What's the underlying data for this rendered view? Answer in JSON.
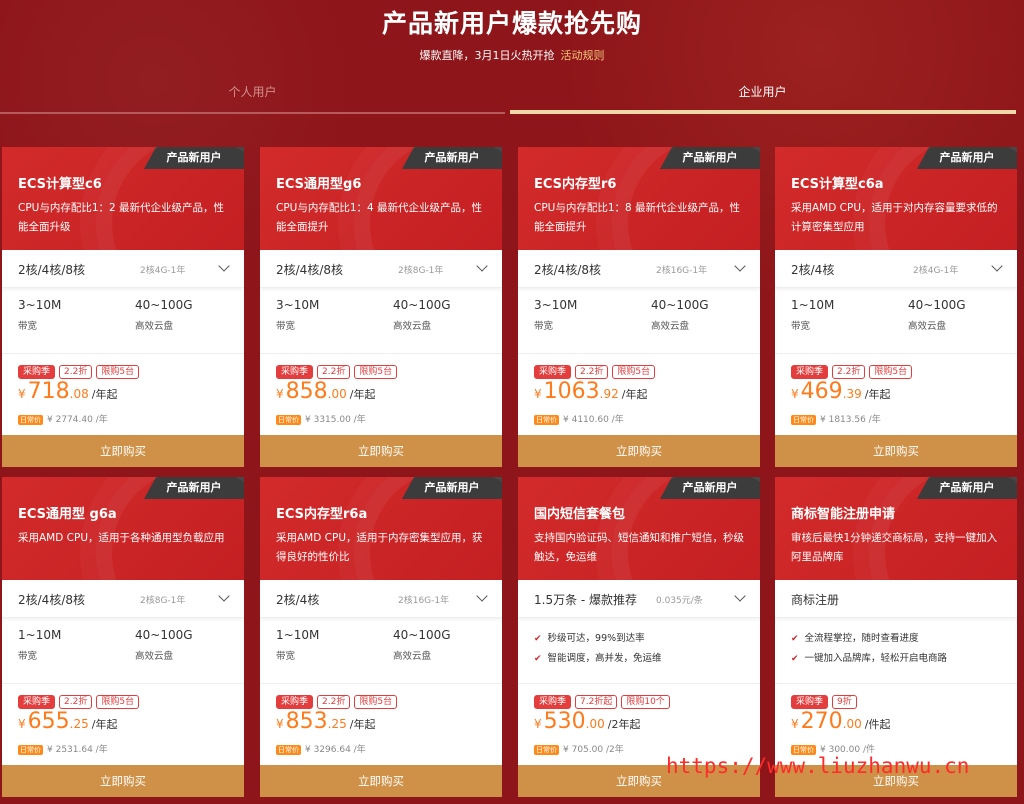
{
  "header": {
    "title": "产品新用户爆款抢先购",
    "subtitle": "爆款直降，3月1日火热开抢",
    "rule_link": "活动规则"
  },
  "tabs": [
    {
      "label": "个人用户",
      "active": false
    },
    {
      "label": "企业用户",
      "active": true
    }
  ],
  "colors": {
    "background": "#8e1519",
    "card_top": "#c41f22",
    "badge": "#3c3c3c",
    "price": "#ff7a1a",
    "buy_button": "#cf9147",
    "tag": "#e33d3d"
  },
  "cards": [
    {
      "badge": "产品新用户",
      "name": "ECS计算型c6",
      "desc": "CPU与内存配比1：2 最新代企业级产品，性能全面升级",
      "spec": "2核/4核/8核",
      "spec_sub": "2核4G-1年",
      "attr1_v": "3~10M",
      "attr1_l": "带宽",
      "attr2_v": "40~100G",
      "attr2_l": "高效云盘",
      "tags": [
        "采购季",
        "2.2折",
        "限购5台"
      ],
      "price_cur": "¥",
      "price_int": "718",
      "price_dec": ".08",
      "price_unit": "/年起",
      "orig_pill": "日常价",
      "orig": "¥ 2774.40 /年",
      "buy": "立即购买"
    },
    {
      "badge": "产品新用户",
      "name": "ECS通用型g6",
      "desc": "CPU与内存配比1：4 最新代企业级产品，性能全面提升",
      "spec": "2核/4核/8核",
      "spec_sub": "2核8G-1年",
      "attr1_v": "3~10M",
      "attr1_l": "带宽",
      "attr2_v": "40~100G",
      "attr2_l": "高效云盘",
      "tags": [
        "采购季",
        "2.2折",
        "限购5台"
      ],
      "price_cur": "¥",
      "price_int": "858",
      "price_dec": ".00",
      "price_unit": "/年起",
      "orig_pill": "日常价",
      "orig": "¥ 3315.00 /年",
      "buy": "立即购买"
    },
    {
      "badge": "产品新用户",
      "name": "ECS内存型r6",
      "desc": "CPU与内存配比1：8 最新代企业级产品，性能全面提升",
      "spec": "2核/4核/8核",
      "spec_sub": "2核16G-1年",
      "attr1_v": "3~10M",
      "attr1_l": "带宽",
      "attr2_v": "40~100G",
      "attr2_l": "高效云盘",
      "tags": [
        "采购季",
        "2.2折",
        "限购5台"
      ],
      "price_cur": "¥",
      "price_int": "1063",
      "price_dec": ".92",
      "price_unit": "/年起",
      "orig_pill": "日常价",
      "orig": "¥ 4110.60 /年",
      "buy": "立即购买"
    },
    {
      "badge": "产品新用户",
      "name": "ECS计算型c6a",
      "desc": "采用AMD CPU，适用于对内存容量要求低的计算密集型应用",
      "spec": "2核/4核",
      "spec_sub": "2核4G-1年",
      "attr1_v": "1~10M",
      "attr1_l": "带宽",
      "attr2_v": "40~100G",
      "attr2_l": "高效云盘",
      "tags": [
        "采购季",
        "2.2折",
        "限购5台"
      ],
      "price_cur": "¥",
      "price_int": "469",
      "price_dec": ".39",
      "price_unit": "/年起",
      "orig_pill": "日常价",
      "orig": "¥ 1813.56 /年",
      "buy": "立即购买"
    },
    {
      "badge": "产品新用户",
      "name": "ECS通用型 g6a",
      "desc": "采用AMD CPU，适用于各种通用型负载应用",
      "spec": "2核/4核/8核",
      "spec_sub": "2核8G-1年",
      "attr1_v": "1~10M",
      "attr1_l": "带宽",
      "attr2_v": "40~100G",
      "attr2_l": "高效云盘",
      "tags": [
        "采购季",
        "2.2折",
        "限购5台"
      ],
      "price_cur": "¥",
      "price_int": "655",
      "price_dec": ".25",
      "price_unit": "/年起",
      "orig_pill": "日常价",
      "orig": "¥ 2531.64 /年",
      "buy": "立即购买"
    },
    {
      "badge": "产品新用户",
      "name": "ECS内存型r6a",
      "desc": "采用AMD CPU，适用于内存密集型应用，获得良好的性价比",
      "spec": "2核/4核",
      "spec_sub": "2核16G-1年",
      "attr1_v": "1~10M",
      "attr1_l": "带宽",
      "attr2_v": "40~100G",
      "attr2_l": "高效云盘",
      "tags": [
        "采购季",
        "2.2折",
        "限购5台"
      ],
      "price_cur": "¥",
      "price_int": "853",
      "price_dec": ".25",
      "price_unit": "/年起",
      "orig_pill": "日常价",
      "orig": "¥ 3296.64 /年",
      "buy": "立即购买"
    },
    {
      "badge": "产品新用户",
      "name": "国内短信套餐包",
      "desc": "支持国内验证码、短信通知和推广短信，秒级触达，免运维",
      "spec": "1.5万条 - 爆款推荐",
      "spec_sub": "0.035元/条",
      "feature1": "秒级可达，99%到达率",
      "feature2": "智能调度，高并发，免运维",
      "tags": [
        "采购季",
        "7.2折起",
        "限购10个"
      ],
      "price_cur": "¥",
      "price_int": "530",
      "price_dec": ".00",
      "price_unit": "/2年起",
      "orig_pill": "日常价",
      "orig": "¥ 705.00 /2年",
      "buy": "立即购买"
    },
    {
      "badge": "产品新用户",
      "name": "商标智能注册申请",
      "desc": "审核后最快1分钟递交商标局，支持一键加入阿里品牌库",
      "spec": "商标注册",
      "spec_sub": "",
      "feature1": "全流程掌控，随时查看进度",
      "feature2": "一键加入品牌库，轻松开启电商路",
      "tags": [
        "采购季",
        "9折"
      ],
      "price_cur": "¥",
      "price_int": "270",
      "price_dec": ".00",
      "price_unit": "/件起",
      "orig_pill": "日常价",
      "orig": "¥ 300.00 /件",
      "buy": "立即购买"
    }
  ],
  "watermark": "https://www.liuzhanwu.cn"
}
